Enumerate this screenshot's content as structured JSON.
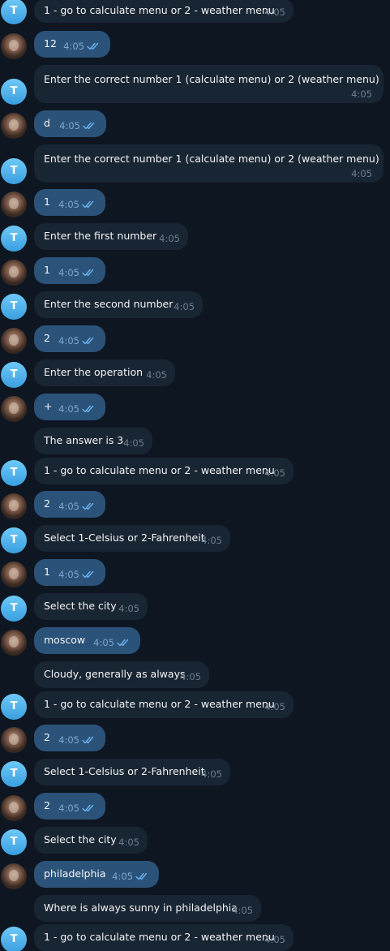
{
  "bot_initial": "T",
  "messages": [
    {
      "sender": "bot",
      "avatar": true,
      "text": "1 - go to calculate menu or 2 - weather menu",
      "time": "4:05"
    },
    {
      "sender": "user",
      "avatar": true,
      "text": "12",
      "time": "4:05",
      "read": true
    },
    {
      "sender": "bot",
      "avatar": true,
      "text": "Enter the correct number 1 (calculate menu) or 2 (weather menu)",
      "time": "4:05"
    },
    {
      "sender": "user",
      "avatar": true,
      "text": "d",
      "time": "4:05",
      "read": true
    },
    {
      "sender": "bot",
      "avatar": true,
      "text": "Enter the correct number 1 (calculate menu) or 2 (weather menu)",
      "time": "4:05"
    },
    {
      "sender": "user",
      "avatar": true,
      "text": "1",
      "time": "4:05",
      "read": true
    },
    {
      "sender": "bot",
      "avatar": true,
      "text": "Enter the first number",
      "time": "4:05"
    },
    {
      "sender": "user",
      "avatar": true,
      "text": "1",
      "time": "4:05",
      "read": true
    },
    {
      "sender": "bot",
      "avatar": true,
      "text": "Enter the second number",
      "time": "4:05"
    },
    {
      "sender": "user",
      "avatar": true,
      "text": "2",
      "time": "4:05",
      "read": true
    },
    {
      "sender": "bot",
      "avatar": true,
      "text": "Enter the operation",
      "time": "4:05"
    },
    {
      "sender": "user",
      "avatar": true,
      "text": "+",
      "time": "4:05",
      "read": true
    },
    {
      "sender": "bot",
      "avatar": false,
      "text": "The answer is 3",
      "time": "4:05"
    },
    {
      "sender": "bot",
      "avatar": true,
      "text": "1 - go to calculate menu or 2 - weather menu",
      "time": "4:05"
    },
    {
      "sender": "user",
      "avatar": true,
      "text": "2",
      "time": "4:05",
      "read": true
    },
    {
      "sender": "bot",
      "avatar": true,
      "text": "Select 1-Celsius or 2-Fahrenheit",
      "time": "4:05"
    },
    {
      "sender": "user",
      "avatar": true,
      "text": "1",
      "time": "4:05",
      "read": true
    },
    {
      "sender": "bot",
      "avatar": true,
      "text": "Select the city",
      "time": "4:05"
    },
    {
      "sender": "user",
      "avatar": true,
      "text": "moscow",
      "time": "4:05",
      "read": true
    },
    {
      "sender": "bot",
      "avatar": false,
      "text": "Cloudy, generally as always",
      "time": "4:05"
    },
    {
      "sender": "bot",
      "avatar": true,
      "text": "1 - go to calculate menu or 2 - weather menu",
      "time": "4:05"
    },
    {
      "sender": "user",
      "avatar": true,
      "text": "2",
      "time": "4:05",
      "read": true
    },
    {
      "sender": "bot",
      "avatar": true,
      "text": "Select 1-Celsius or 2-Fahrenheit",
      "time": "4:05"
    },
    {
      "sender": "user",
      "avatar": true,
      "text": "2",
      "time": "4:05",
      "read": true
    },
    {
      "sender": "bot",
      "avatar": true,
      "text": "Select the city",
      "time": "4:05"
    },
    {
      "sender": "user",
      "avatar": true,
      "text": "philadelphia",
      "time": "4:05",
      "read": true
    },
    {
      "sender": "bot",
      "avatar": false,
      "text": "Where is always sunny in philadelphia",
      "time": "4:05"
    },
    {
      "sender": "bot",
      "avatar": true,
      "text": "1 - go to calculate menu or 2 - weather menu",
      "time": "4:05"
    }
  ]
}
